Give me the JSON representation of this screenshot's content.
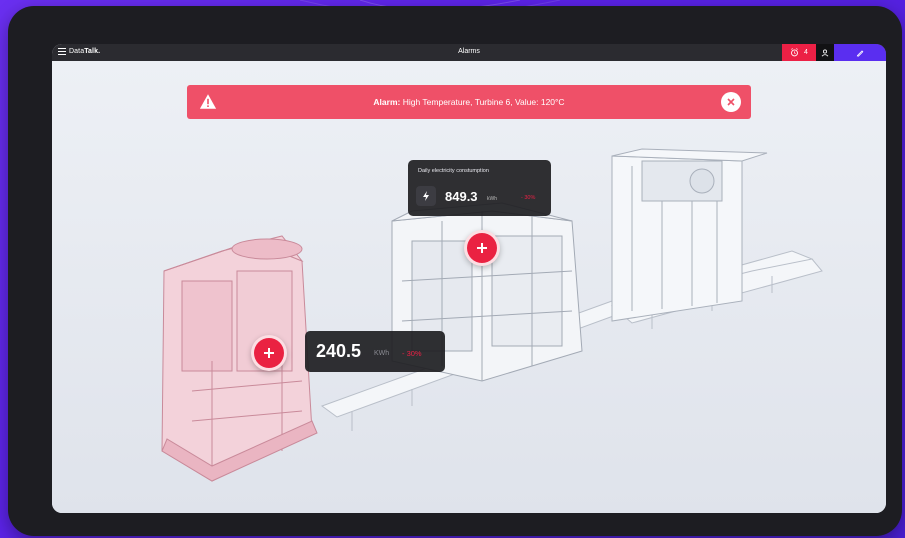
{
  "appbar": {
    "brand_prefix": "Data",
    "brand_suffix": "Talk.",
    "title": "Alarms",
    "alarm_count": "4",
    "alarm_color": "#ec2045",
    "edit_color": "#5a2ef0"
  },
  "icons": {
    "menu": "menu-icon",
    "alarm": "alarm-clock-icon",
    "user": "user-icon",
    "edit": "pencil-icon",
    "warning": "warning-triangle-icon",
    "close": "close-icon",
    "bolt": "lightning-icon",
    "plus": "plus-icon"
  },
  "alarm_banner": {
    "label": "Alarm:",
    "message": "High Temperature, Turbine 6, Value: 120°C",
    "color": "#ef5068"
  },
  "daily_card": {
    "label": "Daily electricity constumption",
    "value": "849.3",
    "unit": "kWh",
    "delta": "- 30%"
  },
  "machine_card": {
    "value": "240.5",
    "unit": "KWh",
    "delta": "- 30%"
  }
}
